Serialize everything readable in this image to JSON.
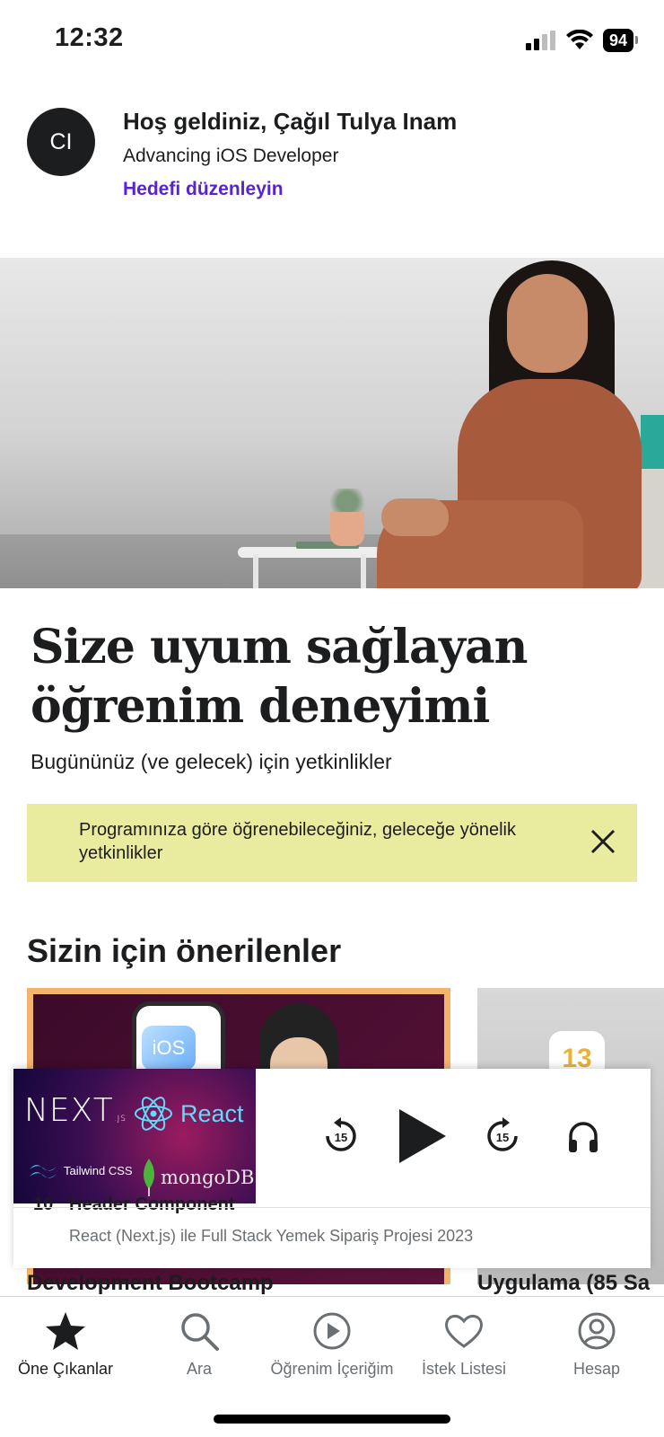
{
  "status_bar": {
    "time": "12:32",
    "battery": "94"
  },
  "header": {
    "avatar_initials": "CI",
    "welcome": "Hoş geldiniz, Çağıl Tulya Inam",
    "goal": "Advancing iOS Developer",
    "edit_goal": "Hedefi düzenleyin"
  },
  "hero": {
    "headline_line1": "Size uyum sağlayan",
    "headline_line2": "öğrenim deneyimi",
    "subheadline": "Bugününüz (ve gelecek) için yetkinlikler"
  },
  "notice": {
    "text": "Programınıza göre öğrenebileceğiniz, geleceğe yönelik yetkinlikler",
    "close_icon": "close-icon"
  },
  "recommended": {
    "title": "Sizin için önerilenler",
    "cards": [
      {
        "title": "Development Bootcamp",
        "thumb_badge": "iOS"
      },
      {
        "title": "Uygulama (85 Sa",
        "thumb_badge": "13"
      }
    ]
  },
  "mini_player": {
    "thumb_labels": {
      "next": "NEXT",
      "next_suffix": ".JS",
      "react": "React",
      "tailwind": "Tailwind CSS",
      "mongo": "mongoDB"
    },
    "controls": {
      "rewind_seconds": "15",
      "forward_seconds": "15"
    },
    "lecture_number": "10",
    "lecture_title": "Header Component",
    "course_title": "React (Next.js) ile Full Stack Yemek Sipariş Projesi 2023"
  },
  "bottom_nav": [
    {
      "label": "Öne Çıkanlar",
      "icon": "star-icon",
      "active": true
    },
    {
      "label": "Ara",
      "icon": "search-icon",
      "active": false
    },
    {
      "label": "Öğrenim İçeriğim",
      "icon": "play-circle-icon",
      "active": false
    },
    {
      "label": "İstek Listesi",
      "icon": "heart-icon",
      "active": false
    },
    {
      "label": "Hesap",
      "icon": "account-icon",
      "active": false
    }
  ],
  "colors": {
    "accent": "#5624d0",
    "notice_bg": "#e9ec9f",
    "text": "#1c1d1f"
  }
}
